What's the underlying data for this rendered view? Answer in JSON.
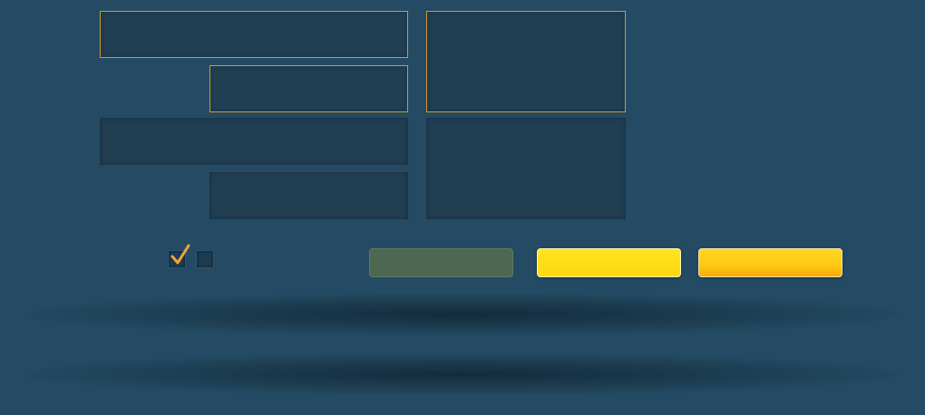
{
  "form": {
    "fields": [
      {
        "id": "f1",
        "value": "",
        "highlighted": true
      },
      {
        "id": "f2",
        "value": "",
        "highlighted": true
      },
      {
        "id": "f3",
        "value": "",
        "highlighted": false
      },
      {
        "id": "f4",
        "value": "",
        "highlighted": false
      },
      {
        "id": "f5",
        "value": "",
        "highlighted": true
      },
      {
        "id": "f6",
        "value": "",
        "highlighted": false
      }
    ],
    "checkboxes": [
      {
        "checked": true
      },
      {
        "checked": false
      }
    ]
  },
  "buttons": {
    "a_label": "",
    "b_label": "",
    "c_label": ""
  },
  "colors": {
    "background": "#244b63",
    "field": "#213f53",
    "highlight_border": "#d39a2e",
    "button_muted": "#4c6853",
    "button_yellow": "#fdd812",
    "button_orange": "#f9a80b",
    "checkmark": "#f0a63a"
  }
}
